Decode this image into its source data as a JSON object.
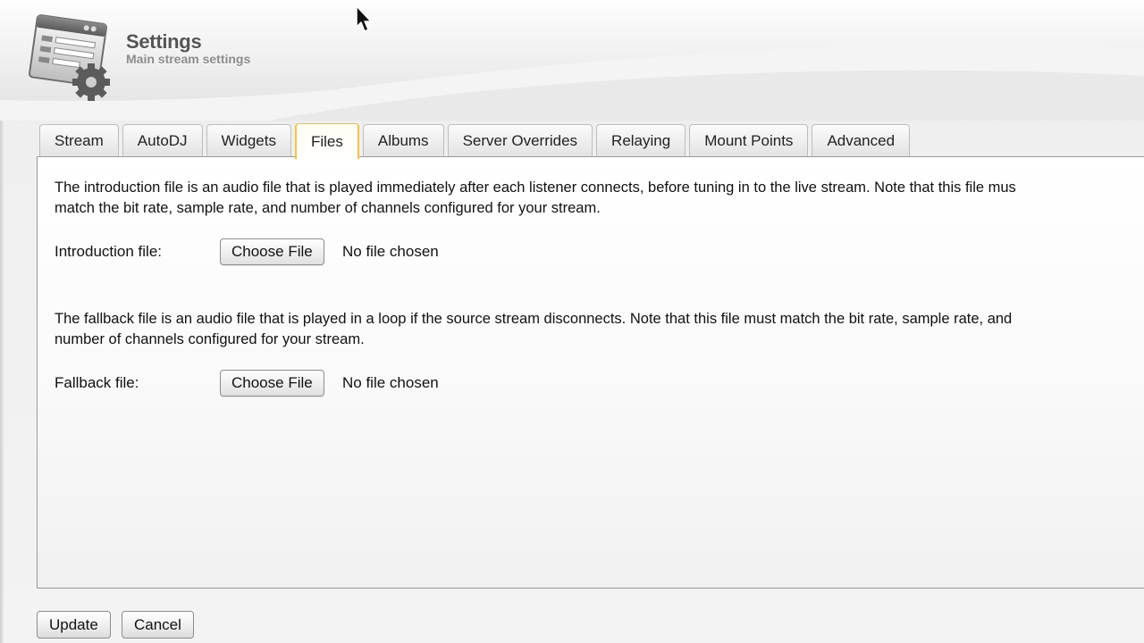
{
  "header": {
    "title": "Settings",
    "subtitle": "Main stream settings"
  },
  "tabs": [
    {
      "label": "Stream",
      "active": false
    },
    {
      "label": "AutoDJ",
      "active": false
    },
    {
      "label": "Widgets",
      "active": false
    },
    {
      "label": "Files",
      "active": true
    },
    {
      "label": "Albums",
      "active": false
    },
    {
      "label": "Server Overrides",
      "active": false
    },
    {
      "label": "Relaying",
      "active": false
    },
    {
      "label": "Mount Points",
      "active": false
    },
    {
      "label": "Advanced",
      "active": false
    }
  ],
  "files": {
    "intro": {
      "description_line1": "The introduction file is an audio file that is played immediately after each listener connects, before tuning in to the live stream. Note that this file mus",
      "description_line2": "match the bit rate, sample rate, and number of channels configured for your stream.",
      "label": "Introduction file:",
      "button_label": "Choose File",
      "status": "No file chosen"
    },
    "fallback": {
      "description_line1": "The fallback file is an audio file that is played in a loop if the source stream disconnects. Note that this file must match the bit rate, sample rate, and",
      "description_line2": "number of channels configured for your stream.",
      "label": "Fallback file:",
      "button_label": "Choose File",
      "status": "No file chosen"
    }
  },
  "actions": {
    "update_label": "Update",
    "cancel_label": "Cancel"
  },
  "colors": {
    "active_tab_accent": "#f1c24e",
    "title_text": "#555555",
    "subtitle_text": "#8a8a8a"
  },
  "icons": {
    "header_icon": "settings-window-gear-icon",
    "cursor": "mouse-pointer-icon"
  }
}
